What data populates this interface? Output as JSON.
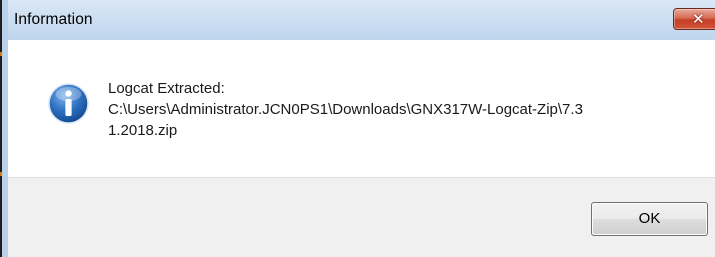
{
  "dialog": {
    "title": "Information",
    "close_glyph": "✕",
    "icon": "information-icon",
    "message_lines": [
      "Logcat Extracted:",
      "C:\\Users\\Administrator.JCN0PS1\\Downloads\\GNX317W-Logcat-Zip\\7.3",
      "1.2018.zip"
    ],
    "ok_label": "OK"
  },
  "colors": {
    "titlebar": "#cddff2",
    "close_button": "#c33f25",
    "content_background": "#ffffff",
    "footer_background": "#f0f0f0",
    "info_icon_blue": "#1f5fae"
  }
}
